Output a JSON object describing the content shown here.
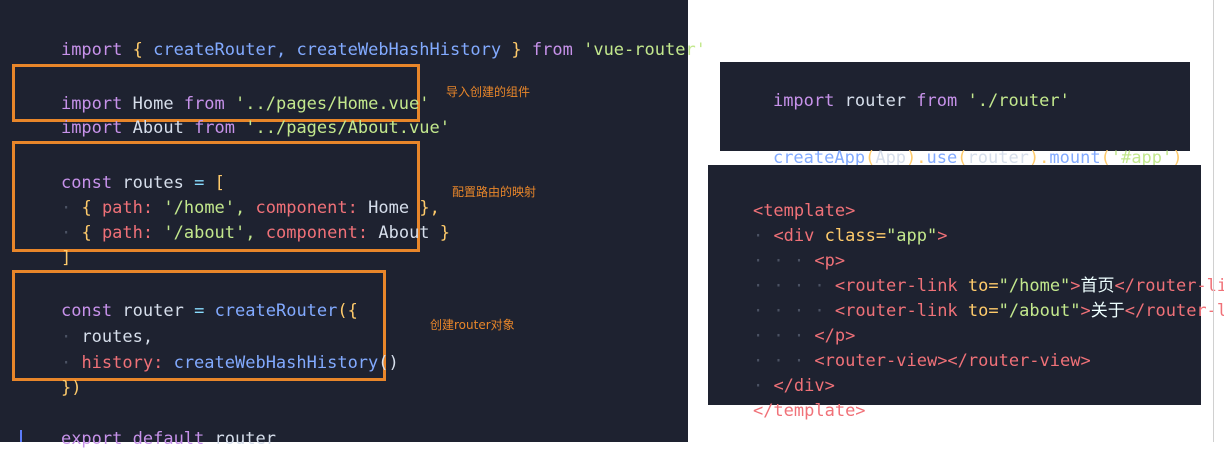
{
  "left_panel": {
    "line1": {
      "kw": "import",
      "open": "{",
      "fn1": "createRouter,",
      "fn2": "createWebHashHistory",
      "close": "}",
      "from": "from",
      "str": "'vue-router'"
    },
    "import_block": {
      "l1": {
        "kw": "import",
        "id": "Home",
        "from": "from",
        "str": "'../pages/Home.vue'"
      },
      "l2": {
        "kw": "import",
        "id": "About",
        "from": "from",
        "str": "'../pages/About.vue'"
      },
      "note": "导入创建的组件"
    },
    "routes_block": {
      "l1": {
        "kw": "const",
        "id": "routes",
        "op": "=",
        "open": "["
      },
      "l2": {
        "open": "{",
        "path_key": "path:",
        "path_val": "'/home',",
        "comp_key": "component:",
        "comp_val": "Home",
        "close": "},"
      },
      "l3": {
        "open": "{",
        "path_key": "path:",
        "path_val": "'/about',",
        "comp_key": "component:",
        "comp_val": "About",
        "close": "}"
      },
      "l4": {
        "close": "]"
      },
      "note": "配置路由的映射"
    },
    "router_block": {
      "l1": {
        "kw": "const",
        "id": "router",
        "op": "=",
        "fn": "createRouter",
        "open": "({"
      },
      "l2": {
        "id": "routes,"
      },
      "l3": {
        "key": "history:",
        "fn": "createWebHashHistory",
        "call": "()"
      },
      "l4": {
        "close": "})"
      },
      "note": "创建router对象"
    },
    "export_line": {
      "kw1": "export",
      "kw2": "default",
      "id": "router"
    }
  },
  "main_panel": {
    "l1": {
      "kw": "import",
      "id": "router",
      "from": "from",
      "str": "'./router'"
    },
    "l2": {
      "fn1": "createApp",
      "p1": "(",
      "id1": "App",
      "p2": ").",
      "fn2": "use",
      "p3": "(",
      "id2": "router",
      "p4": ").",
      "fn3": "mount",
      "p5": "(",
      "str": "'#app'",
      "p6": ")"
    }
  },
  "template_panel": {
    "l1": {
      "tag": "<template>"
    },
    "l2": {
      "tag": "<div",
      "attr": "class=",
      "val": "\"app\"",
      "end": ">"
    },
    "l3": {
      "tag": "<p>"
    },
    "l4": {
      "tag": "<router-link",
      "attr": "to=",
      "val": "\"/home\"",
      "end": ">",
      "text": "首页",
      "close": "</router-link>"
    },
    "l5": {
      "tag": "<router-link",
      "attr": "to=",
      "val": "\"/about\"",
      "end": ">",
      "text": "关于",
      "close": "</router-link>"
    },
    "l6": {
      "tag": "</p>"
    },
    "l7": {
      "tag": "<router-view></router-view>"
    },
    "l8": {
      "tag": "</div>"
    },
    "l9": {
      "tag": "</template>"
    }
  }
}
